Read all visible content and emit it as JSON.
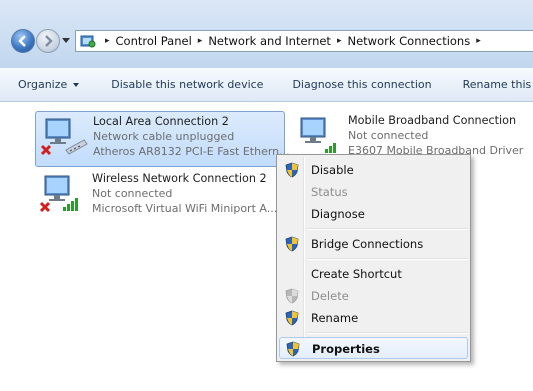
{
  "address_bar": {
    "crumbs": [
      "Control Panel",
      "Network and Internet",
      "Network Connections"
    ],
    "separator": "▸"
  },
  "toolbar": {
    "organize": "Organize",
    "disable": "Disable this network device",
    "diagnose": "Diagnose this connection",
    "rename": "Rename this co"
  },
  "connections": [
    {
      "name": "Local Area Connection 2",
      "status": "Network cable unplugged",
      "device": "Atheros AR8132 PCI-E Fast Ethern..."
    },
    {
      "name": "Mobile Broadband Connection",
      "status": "Not connected",
      "device": "E3607 Mobile Broadband Driver"
    },
    {
      "name": "Wireless Network Connection 2",
      "status": "Not connected",
      "device": "Microsoft Virtual WiFi Miniport A..."
    }
  ],
  "context_menu": {
    "items": [
      {
        "label": "Disable",
        "icon": "shield-icon",
        "enabled": true
      },
      {
        "label": "Status",
        "icon": "",
        "enabled": false
      },
      {
        "label": "Diagnose",
        "icon": "",
        "enabled": true
      },
      {
        "label": "Bridge Connections",
        "icon": "shield-icon",
        "enabled": true
      },
      {
        "label": "Create Shortcut",
        "icon": "",
        "enabled": true
      },
      {
        "label": "Delete",
        "icon": "shield-icon",
        "enabled": false
      },
      {
        "label": "Rename",
        "icon": "shield-icon",
        "enabled": true
      },
      {
        "label": "Properties",
        "icon": "shield-icon",
        "enabled": true,
        "default": true,
        "highlighted": true
      }
    ]
  },
  "colors": {
    "selection": "#c2dcfd",
    "toolbar_text": "#1e395b",
    "disabled_x": "#d21e1e",
    "signal_green": "#2f9a2f"
  }
}
